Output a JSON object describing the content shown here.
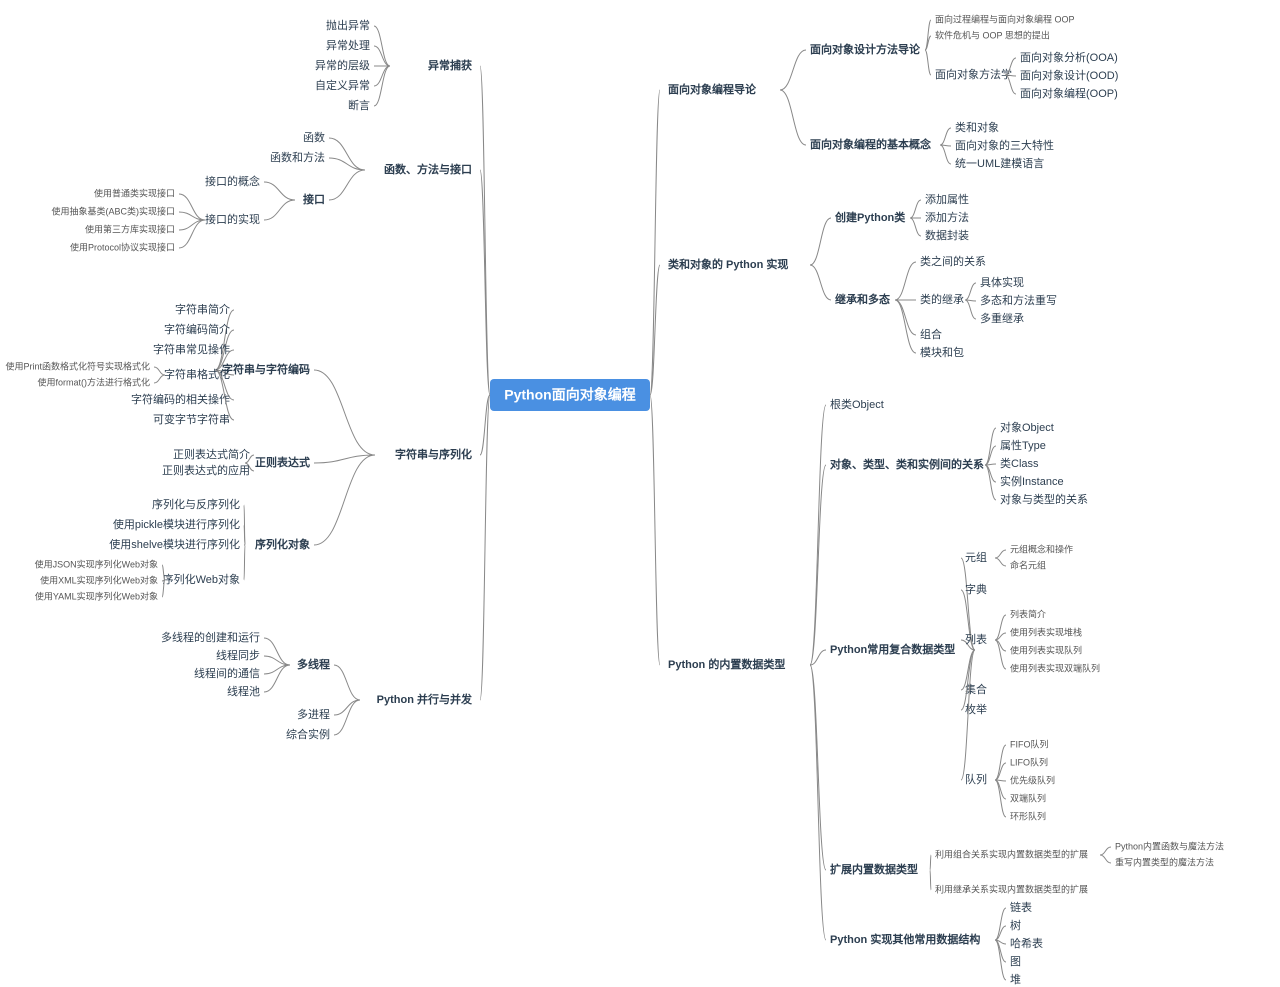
{
  "root": "Python面向对象编程",
  "left": {
    "b0": {
      "label": "异常捕获",
      "children": [
        "抛出异常",
        "异常处理",
        "异常的层级",
        "自定义异常",
        "断言"
      ]
    },
    "b1": {
      "label": "函数、方法与接口",
      "children": {
        "c0": "函数",
        "c1": "函数和方法",
        "c2": {
          "label": "接口",
          "children": {
            "d0": "接口的概念",
            "d1": {
              "label": "接口的实现",
              "children": [
                "使用普通类实现接口",
                "使用抽象基类(ABC类)实现接口",
                "使用第三方库实现接口",
                "使用Protocol协议实现接口"
              ]
            }
          }
        }
      }
    },
    "b2": {
      "label": "字符串与序列化",
      "children": {
        "c0": {
          "label": "字符串与字符编码",
          "children": {
            "d0": "字符串简介",
            "d1": "字符编码简介",
            "d2": "字符串常见操作",
            "d3": {
              "label": "字符串格式化",
              "children": [
                "使用Print函数格式化符号实现格式化",
                "使用format()方法进行格式化"
              ]
            },
            "d4": "字符编码的相关操作",
            "d5": "可变字节字符串"
          }
        },
        "c1": {
          "label": "正则表达式",
          "children": [
            "正则表达式简介",
            "正则表达式的应用"
          ]
        },
        "c2": {
          "label": "序列化对象",
          "children": {
            "d0": "序列化与反序列化",
            "d1": "使用pickle模块进行序列化",
            "d2": "使用shelve模块进行序列化",
            "d3": {
              "label": "序列化Web对象",
              "children": [
                "使用JSON实现序列化Web对象",
                "使用XML实现序列化Web对象",
                "使用YAML实现序列化Web对象"
              ]
            }
          }
        }
      }
    },
    "b3": {
      "label": "Python 并行与并发",
      "children": {
        "c0": {
          "label": "多线程",
          "children": [
            "多线程的创建和运行",
            "线程同步",
            "线程间的通信",
            "线程池"
          ]
        },
        "c1": "多进程",
        "c2": "综合实例"
      }
    }
  },
  "right": {
    "b0": {
      "label": "面向对象编程导论",
      "children": {
        "c0": {
          "label": "面向对象设计方法导论",
          "children": {
            "d0": "面向过程编程与面向对象编程 OOP",
            "d1": "软件危机与 OOP 思想的提出",
            "d2": {
              "label": "面向对象方法学",
              "children": [
                "面向对象分析(OOA)",
                "面向对象设计(OOD)",
                "面向对象编程(OOP)"
              ]
            }
          }
        },
        "c1": {
          "label": "面向对象编程的基本概念",
          "children": [
            "类和对象",
            "面向对象的三大特性",
            "统一UML建模语言"
          ]
        }
      }
    },
    "b1": {
      "label": "类和对象的 Python 实现",
      "children": {
        "c0": {
          "label": "创建Python类",
          "children": [
            "添加属性",
            "添加方法",
            "数据封装"
          ]
        },
        "c1": {
          "label": "继承和多态",
          "children": {
            "d0": "类之间的关系",
            "d1": {
              "label": "类的继承",
              "children": [
                "具体实现",
                "多态和方法重写",
                "多重继承"
              ]
            },
            "d2": "组合",
            "d3": "模块和包"
          }
        }
      }
    },
    "b2": {
      "label": "Python 的内置数据类型",
      "children": {
        "c0": "根类Object",
        "c1": {
          "label": "对象、类型、类和实例间的关系",
          "children": [
            "对象Object",
            "属性Type",
            "类Class",
            "实例Instance",
            "对象与类型的关系"
          ]
        },
        "c2": {
          "label": "Python常用复合数据类型",
          "children": {
            "d0": {
              "label": "元组",
              "children": [
                "元组概念和操作",
                "命名元组"
              ]
            },
            "d1": "字典",
            "d2": {
              "label": "列表",
              "children": [
                "列表简介",
                "使用列表实现堆栈",
                "使用列表实现队列",
                "使用列表实现双端队列"
              ]
            },
            "d3": "集合",
            "d4": "枚举",
            "d5": {
              "label": "队列",
              "children": [
                "FIFO队列",
                "LIFO队列",
                "优先级队列",
                "双端队列",
                "环形队列"
              ]
            }
          }
        },
        "c3": {
          "label": "扩展内置数据类型",
          "children": {
            "d0": {
              "label": "利用组合关系实现内置数据类型的扩展",
              "children": [
                "Python内置函数与魔法方法",
                "重写内置类型的魔法方法"
              ]
            },
            "d1": "利用继承关系实现内置数据类型的扩展"
          }
        },
        "c4": {
          "label": "Python 实现其他常用数据结构",
          "children": [
            "链表",
            "树",
            "哈希表",
            "图",
            "堆"
          ]
        }
      }
    }
  }
}
